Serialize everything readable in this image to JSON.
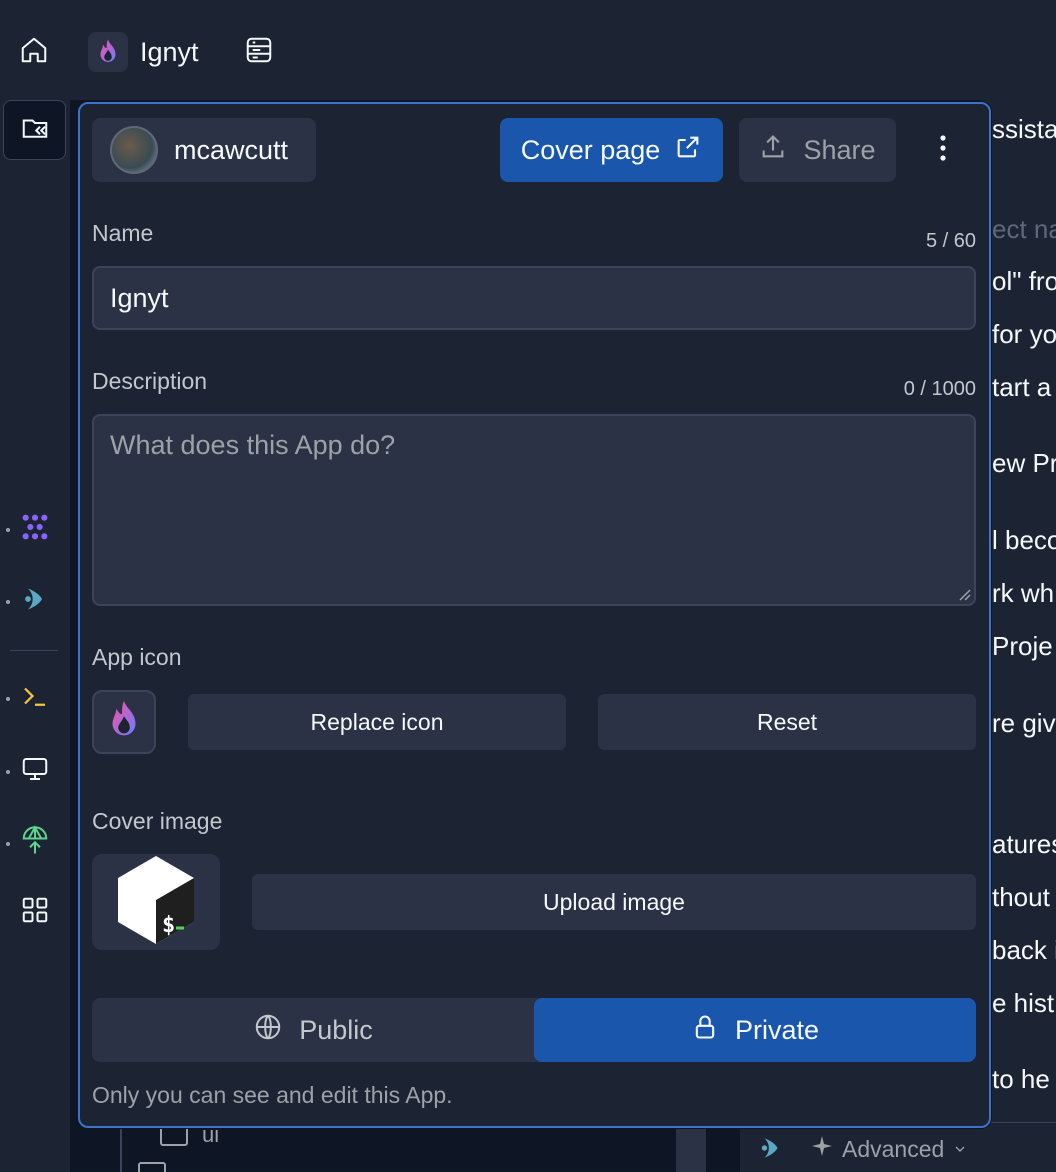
{
  "topbar": {
    "app_name": "Ignyt"
  },
  "background_text": {
    "lines": [
      "ssistan",
      "ect na",
      "ol\" fro",
      "for yo",
      "tart a",
      "ew Pr",
      "l beco",
      "rk wh",
      "Proje",
      "re give",
      "atures",
      "thout",
      "back i",
      "e hist",
      "to he"
    ]
  },
  "file_tree": {
    "item_label": "ui"
  },
  "bottom_bar": {
    "advanced_label": "Advanced"
  },
  "popover": {
    "owner": "mcawcutt",
    "cover_page_label": "Cover page",
    "share_label": "Share",
    "name": {
      "label": "Name",
      "value": "Ignyt",
      "counter": "5 / 60"
    },
    "description": {
      "label": "Description",
      "placeholder": "What does this App do?",
      "counter": "0 / 1000"
    },
    "app_icon": {
      "label": "App icon",
      "replace_label": "Replace icon",
      "reset_label": "Reset"
    },
    "cover_image": {
      "label": "Cover image",
      "upload_label": "Upload image"
    },
    "visibility": {
      "public_label": "Public",
      "private_label": "Private",
      "selected": "Private"
    },
    "help_text": "Only you can see and edit this App."
  },
  "colors": {
    "accent": "#1a56ab",
    "focus_border": "#3b73c9",
    "surface": "#1c2333",
    "field": "#2b3245"
  }
}
